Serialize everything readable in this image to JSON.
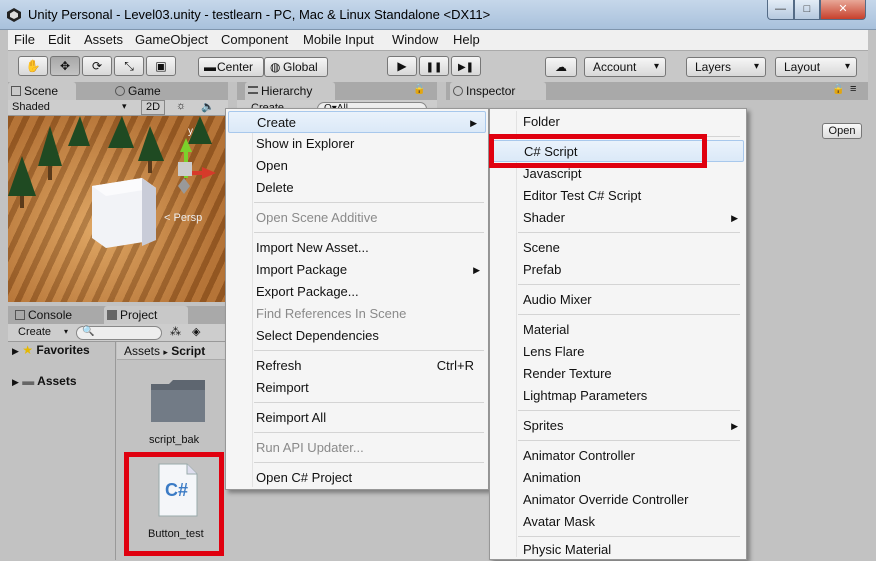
{
  "window": {
    "title": "Unity Personal - Level03.unity - testlearn - PC, Mac & Linux Standalone <DX11>",
    "min": "—",
    "max": "□",
    "close": "✕"
  },
  "menubar": [
    "File",
    "Edit",
    "Assets",
    "GameObject",
    "Component",
    "Mobile Input",
    "Window",
    "Help"
  ],
  "toolbar": {
    "center": "Center",
    "global": "Global",
    "account": "Account",
    "layers": "Layers",
    "layout": "Layout",
    "play": "▶",
    "pause": "❚❚",
    "step": "▶❚"
  },
  "scene": {
    "tab_scene": "Scene",
    "tab_game": "Game",
    "shading": "Shaded",
    "mode_2d": "2D",
    "persp": "< Persp",
    "gizmo_y": "y"
  },
  "hierarchy": {
    "tab": "Hierarchy",
    "create": "Create",
    "search_placeholder": "Q▾All"
  },
  "inspector": {
    "tab": "Inspector",
    "open": "Open"
  },
  "project": {
    "tab_console": "Console",
    "tab_project": "Project",
    "create": "Create",
    "favorites": "Favorites",
    "assets": "Assets",
    "breadcrumb_root": "Assets",
    "breadcrumb_sep": "▸",
    "breadcrumb_current": "Script",
    "files": [
      {
        "name": "script_bak",
        "icon": "folder-icon"
      },
      {
        "name": "Button_test",
        "icon": "csharp-file-icon",
        "glyph": "C#"
      }
    ]
  },
  "context_menu": {
    "items": [
      {
        "label": "Create",
        "submenu": true,
        "highlighted": true
      },
      {
        "label": "Show in Explorer"
      },
      {
        "label": "Open"
      },
      {
        "label": "Delete"
      },
      {
        "label": "Open Scene Additive",
        "disabled": true
      },
      {
        "label": "Import New Asset..."
      },
      {
        "label": "Import Package",
        "submenu": true
      },
      {
        "label": "Export Package..."
      },
      {
        "label": "Find References In Scene",
        "disabled": true
      },
      {
        "label": "Select Dependencies"
      },
      {
        "label": "Refresh",
        "shortcut": "Ctrl+R"
      },
      {
        "label": "Reimport"
      },
      {
        "label": "Reimport All"
      },
      {
        "label": "Run API Updater...",
        "disabled": true
      },
      {
        "label": "Open C# Project"
      }
    ]
  },
  "create_submenu": {
    "items": [
      {
        "label": "Folder"
      },
      {
        "label": "C# Script",
        "highlighted": true
      },
      {
        "label": "Javascript"
      },
      {
        "label": "Editor Test C# Script"
      },
      {
        "label": "Shader",
        "submenu": true
      },
      {
        "label": "Scene"
      },
      {
        "label": "Prefab"
      },
      {
        "label": "Audio Mixer"
      },
      {
        "label": "Material"
      },
      {
        "label": "Lens Flare"
      },
      {
        "label": "Render Texture"
      },
      {
        "label": "Lightmap Parameters"
      },
      {
        "label": "Sprites",
        "submenu": true
      },
      {
        "label": "Animator Controller"
      },
      {
        "label": "Animation"
      },
      {
        "label": "Animator Override Controller"
      },
      {
        "label": "Avatar Mask"
      },
      {
        "label": "Physic Material"
      }
    ]
  },
  "colors": {
    "highlight_box": "#e0000f",
    "menu_bg": "#f5f5f5",
    "menu_highlight": "#dbe9f8"
  }
}
